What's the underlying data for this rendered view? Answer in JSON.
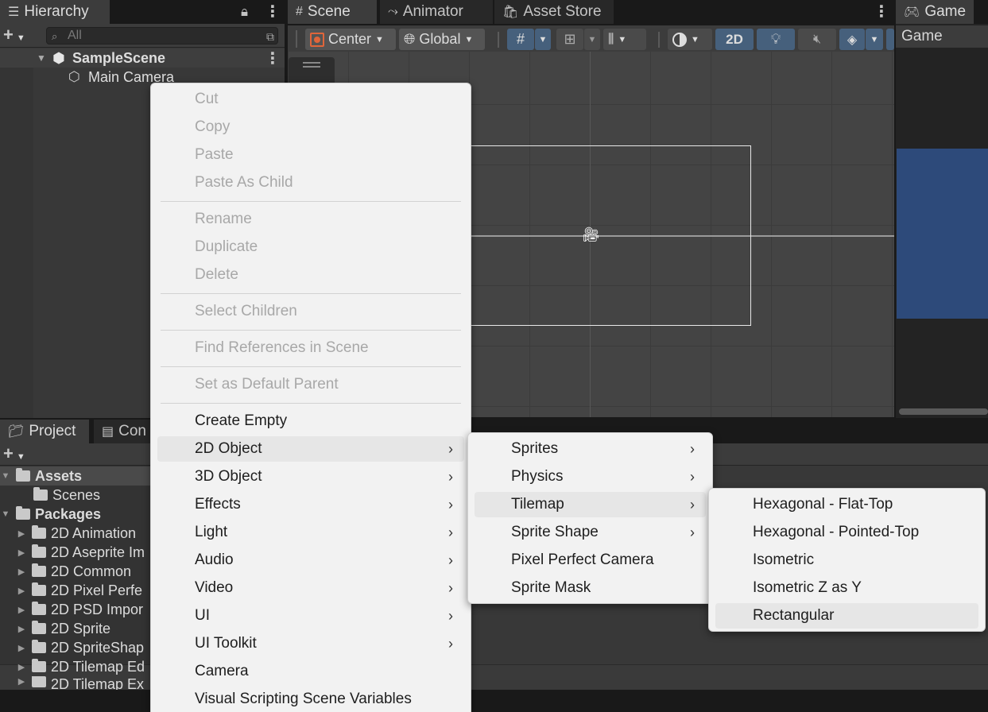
{
  "hierarchy": {
    "tab_label": "Hierarchy",
    "search_placeholder": "All",
    "scene_name": "SampleScene",
    "camera_name": "Main Camera"
  },
  "scene_tabs": {
    "scene": "Scene",
    "animator": "Animator",
    "asset_store": "Asset Store"
  },
  "scene_toolbar": {
    "pivot": "Center",
    "space": "Global",
    "mode_2d": "2D"
  },
  "game": {
    "tab_label": "Game",
    "dropdown": "Game",
    "accent": "#2d4a7a"
  },
  "project": {
    "tab_project": "Project",
    "tab_console": "Con",
    "tree": [
      {
        "label": "Assets",
        "bold": true
      },
      {
        "label": "Scenes",
        "bold": false
      },
      {
        "label": "Packages",
        "bold": true
      },
      {
        "label": "2D Animation",
        "bold": false
      },
      {
        "label": "2D Aseprite Im",
        "bold": false
      },
      {
        "label": "2D Common",
        "bold": false
      },
      {
        "label": "2D Pixel Perfe",
        "bold": false
      },
      {
        "label": "2D PSD Impor",
        "bold": false
      },
      {
        "label": "2D Sprite",
        "bold": false
      },
      {
        "label": "2D SpriteShap",
        "bold": false
      },
      {
        "label": "2D Tilemap Ed",
        "bold": false
      },
      {
        "label": "2D Tilemap Ex",
        "bold": false
      }
    ]
  },
  "context_menu": {
    "cut": "Cut",
    "copy": "Copy",
    "paste": "Paste",
    "paste_as_child": "Paste As Child",
    "rename": "Rename",
    "duplicate": "Duplicate",
    "delete": "Delete",
    "select_children": "Select Children",
    "find_references": "Find References in Scene",
    "set_default_parent": "Set as Default Parent",
    "create_empty": "Create Empty",
    "obj_2d": "2D Object",
    "obj_3d": "3D Object",
    "effects": "Effects",
    "light": "Light",
    "audio": "Audio",
    "video": "Video",
    "ui": "UI",
    "ui_toolkit": "UI Toolkit",
    "camera": "Camera",
    "visual_scripting": "Visual Scripting Scene Variables"
  },
  "submenu_2d": {
    "sprites": "Sprites",
    "physics": "Physics",
    "tilemap": "Tilemap",
    "sprite_shape": "Sprite Shape",
    "pixel_perfect_camera": "Pixel Perfect Camera",
    "sprite_mask": "Sprite Mask"
  },
  "submenu_tilemap": {
    "hex_flat": "Hexagonal - Flat-Top",
    "hex_pointed": "Hexagonal - Pointed-Top",
    "isometric": "Isometric",
    "isometric_z_as_y": "Isometric Z as Y",
    "rectangular": "Rectangular"
  }
}
